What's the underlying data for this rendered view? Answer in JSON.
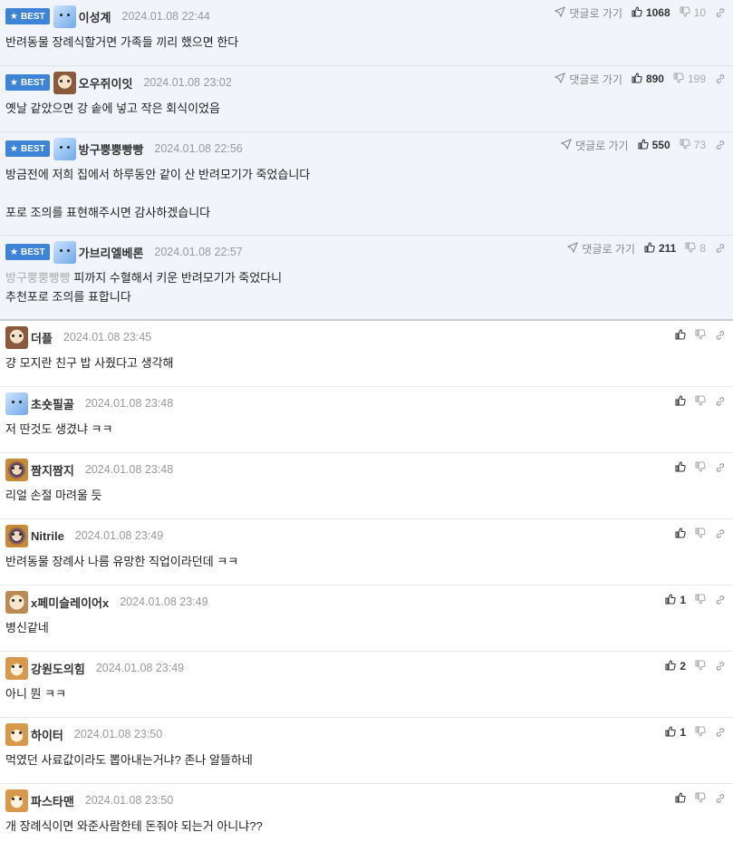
{
  "best_label": "BEST",
  "reply_label": "댓글로 가기",
  "best_comments": [
    {
      "nick": "이성계",
      "date": "2024.01.08 22:44",
      "up": "1068",
      "down": "10",
      "avatar": "bluedog",
      "lines": [
        "반려동물 장례식할거면 가족들 끼리 했으면 한다"
      ]
    },
    {
      "nick": "오우쥐이잇",
      "date": "2024.01.08 23:02",
      "up": "890",
      "down": "199",
      "avatar": "pug",
      "lines": [
        "옛날 같았으면 강 솥에 넣고 작은 회식이었음"
      ]
    },
    {
      "nick": "방구뿡뿡빵빵",
      "date": "2024.01.08 22:56",
      "up": "550",
      "down": "73",
      "avatar": "bluedog",
      "lines": [
        "방금전에 저희 집에서 하루동안 같이 산 반려모기가 죽었습니다",
        "",
        "포로 조의를 표현해주시면 감사하겠습니다"
      ]
    },
    {
      "nick": "가브리엘베론",
      "date": "2024.01.08 22:57",
      "up": "211",
      "down": "8",
      "avatar": "bluedog",
      "mention": "방구뿡뿡빵빵",
      "lines": [
        " 피까지 수혈해서 키운 반려모기가 죽었다니",
        "추천포로 조의를 표합니다"
      ]
    }
  ],
  "comments": [
    {
      "nick": "더플",
      "date": "2024.01.08 23:45",
      "up": "",
      "avatar": "pug",
      "text": "걍 모지란 친구 밥 사줬다고 생각해"
    },
    {
      "nick": "초숏필골",
      "date": "2024.01.08 23:48",
      "up": "",
      "avatar": "bluedog",
      "text": "저 딴것도 생겼냐 ㅋㅋ"
    },
    {
      "nick": "짬지짬지",
      "date": "2024.01.08 23:48",
      "up": "",
      "avatar": "lion",
      "text": "리얼 손절 마려울 듯"
    },
    {
      "nick": "Nitrile",
      "date": "2024.01.08 23:49",
      "up": "",
      "avatar": "lion",
      "text": "반려동물 장례사 나름 유망한 직업이라던데 ㅋㅋ"
    },
    {
      "nick": "x페미슬레이어x",
      "date": "2024.01.08 23:49",
      "up": "1",
      "avatar": "small",
      "text": "병신같네"
    },
    {
      "nick": "강원도의힘",
      "date": "2024.01.08 23:49",
      "up": "2",
      "avatar": "shiba",
      "text": "아니 뭔 ㅋㅋ"
    },
    {
      "nick": "하이터",
      "date": "2024.01.08 23:50",
      "up": "1",
      "avatar": "shiba",
      "text": "먹였던 사료값이라도 뽑아내는거냐? 존나 알뜰하네"
    },
    {
      "nick": "파스타맨",
      "date": "2024.01.08 23:50",
      "up": "",
      "avatar": "shiba",
      "text": "개 장례식이면 와준사람한테 돈줘야 되는거 아니냐??"
    }
  ]
}
